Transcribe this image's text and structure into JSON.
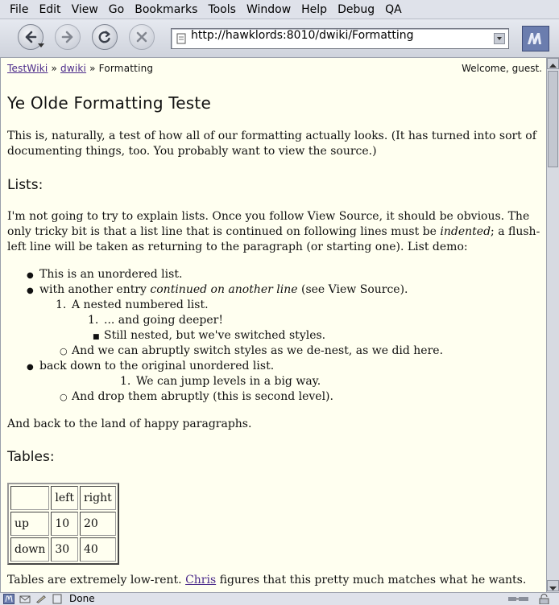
{
  "menu": [
    "File",
    "Edit",
    "View",
    "Go",
    "Bookmarks",
    "Tools",
    "Window",
    "Help",
    "Debug",
    "QA"
  ],
  "url": "http://hawklords:8010/dwiki/Formatting",
  "status": "Done",
  "breadcrumb": {
    "root": "TestWiki",
    "sep1": "»",
    "mid": "dwiki",
    "sep2": "»",
    "current": "Formatting"
  },
  "welcome": "Welcome, guest.",
  "title": "Ye Olde Formatting Teste",
  "intro": "This is, naturally, a test of how all of our formatting actually looks. (It has turned into sort of documenting things, too. You probably want to view the source.)",
  "lists_heading": "Lists:",
  "lists_para": {
    "a": "I'm not going to try to explain lists. Once you follow View Source, it should be obvious. The only tricky bit is that a list line that is continued on following lines must be ",
    "em": "indented",
    "b": "; a flush-left line will be taken as returning to the paragraph (or starting one). List demo:"
  },
  "list_items": {
    "i1": "This is an unordered list.",
    "i2a": "with another entry ",
    "i2em": "continued on another line",
    "i2b": " (see View Source).",
    "n1": "A nested numbered list.",
    "n2": "... and going deeper!",
    "s1": "Still nested, but we've switched styles.",
    "c1": "And we can abruptly switch styles as we de-nest, as we did here.",
    "i3": "back down to the original unordered list.",
    "n3": "We can jump levels in a big way.",
    "c2": "And drop them abruptly (this is second level).",
    "num": "1."
  },
  "after_lists": "And back to the land of happy paragraphs.",
  "tables_heading": "Tables:",
  "table": {
    "header": [
      "",
      "left",
      "right"
    ],
    "rows": [
      [
        "up",
        "10",
        "20"
      ],
      [
        "down",
        "30",
        "40"
      ]
    ]
  },
  "tables_para": {
    "a": "Tables are extremely low-rent. ",
    "link": "Chris",
    "b": " figures that this pretty much matches what he wants."
  }
}
